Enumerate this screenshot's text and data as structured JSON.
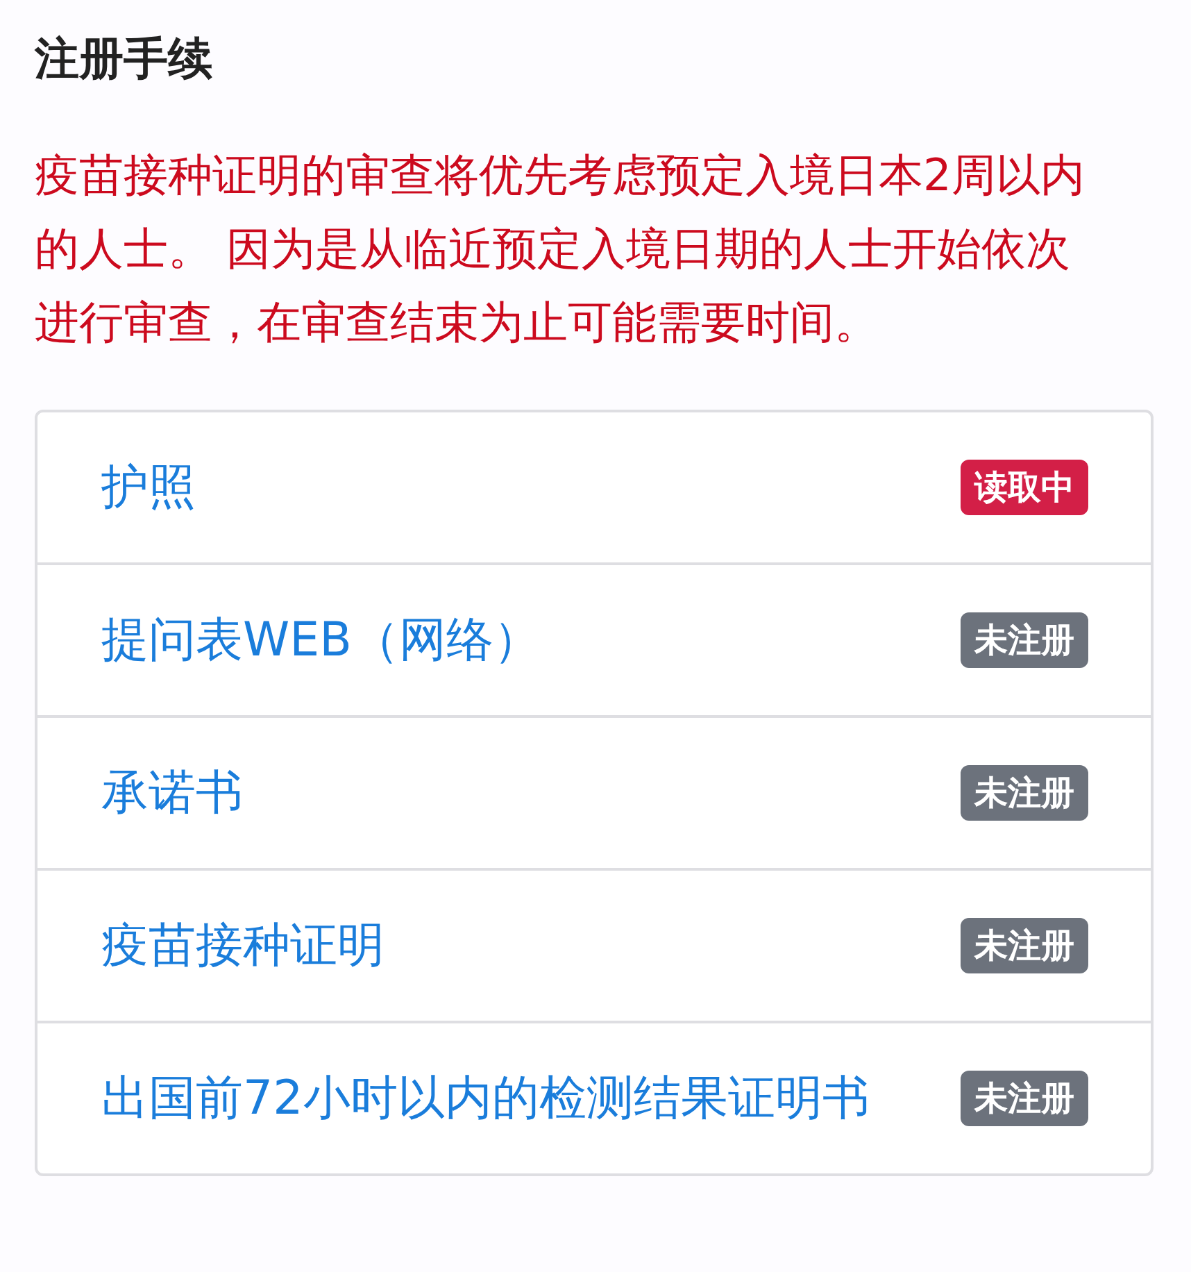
{
  "title": "注册手续",
  "notice": "疫苗接种证明的审查将优先考虑预定入境日本2周以内的人士。 因为是从临近预定入境日期的人士开始依次进行审查，在审查结束为止可能需要时间。",
  "items": [
    {
      "label": "护照",
      "status": "读取中",
      "color": "#d31f47"
    },
    {
      "label": "提问表WEB（网络）",
      "status": "未注册",
      "color": "#6c727c"
    },
    {
      "label": "承诺书",
      "status": "未注册",
      "color": "#6c727c"
    },
    {
      "label": "疫苗接种证明",
      "status": "未注册",
      "color": "#6c727c"
    },
    {
      "label": "出国前72小时以内的检测结果证明书",
      "status": "未注册",
      "color": "#6c727c"
    }
  ]
}
